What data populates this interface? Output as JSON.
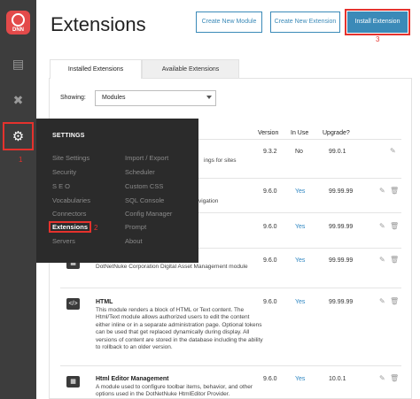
{
  "app": {
    "logo_text": "DNN"
  },
  "rail": {
    "icons": [
      "document-icon",
      "tools-icon",
      "gear-icon"
    ],
    "settings_marker": "1"
  },
  "header": {
    "title": "Extensions",
    "create_module_label": "Create New Module",
    "create_extension_label": "Create New Extension",
    "install_extension_label": "Install Extension",
    "install_marker": "3"
  },
  "tabs": [
    {
      "label": "Installed Extensions",
      "active": true
    },
    {
      "label": "Available Extensions",
      "active": false
    }
  ],
  "filter": {
    "label": "Showing:",
    "value": "Modules"
  },
  "table": {
    "headers": {
      "version": "Version",
      "in_use": "In Use",
      "upgrade": "Upgrade?"
    },
    "rows": [
      {
        "name": "",
        "desc_fragment": "ings for sites",
        "version": "9.3.2",
        "in_use": "No",
        "upgrade": "99.0.1",
        "deletable": false
      },
      {
        "name": "",
        "desc_fragment": "vigation",
        "version": "9.6.0",
        "in_use": "Yes",
        "upgrade": "99.99.99",
        "deletable": true
      },
      {
        "name": "",
        "desc_fragment": "",
        "version": "9.6.0",
        "in_use": "Yes",
        "upgrade": "99.99.99",
        "deletable": true
      },
      {
        "name": "",
        "desc_fragment": "DotNetNuke Corporation Digital Asset Management module",
        "version": "9.6.0",
        "in_use": "Yes",
        "upgrade": "99.99.99",
        "deletable": true
      },
      {
        "name": "HTML",
        "desc_fragment": "This module renders a block of HTML or Text content. The Html/Text module allows authorized users to edit the content either inline or in a separate administration page. Optional tokens can be used that get replaced dynamically during display. All versions of content are stored in the database including the ability to rollback to an older version.",
        "version": "9.6.0",
        "in_use": "Yes",
        "upgrade": "99.99.99",
        "deletable": true
      },
      {
        "name": "Html Editor Management",
        "desc_fragment": "A module used to configure toolbar items, behavior, and other options used in the DotNetNuke HtmlEditor Provider.",
        "version": "9.6.0",
        "in_use": "Yes",
        "upgrade": "10.0.1",
        "deletable": true
      }
    ]
  },
  "flyout": {
    "title": "SETTINGS",
    "left_items": [
      "Site Settings",
      "Security",
      "S E O",
      "Vocabularies",
      "Connectors",
      "Extensions",
      "Servers"
    ],
    "right_items": [
      "Import / Export",
      "Scheduler",
      "Custom CSS",
      "SQL Console",
      "Config Manager",
      "Prompt",
      "About"
    ],
    "active_item": "Extensions",
    "extensions_marker": "2"
  },
  "colors": {
    "accent": "#3b8ab8",
    "highlight_red": "#e5322d",
    "rail": "#3d3d3d",
    "flyout": "#2b2b2b"
  }
}
